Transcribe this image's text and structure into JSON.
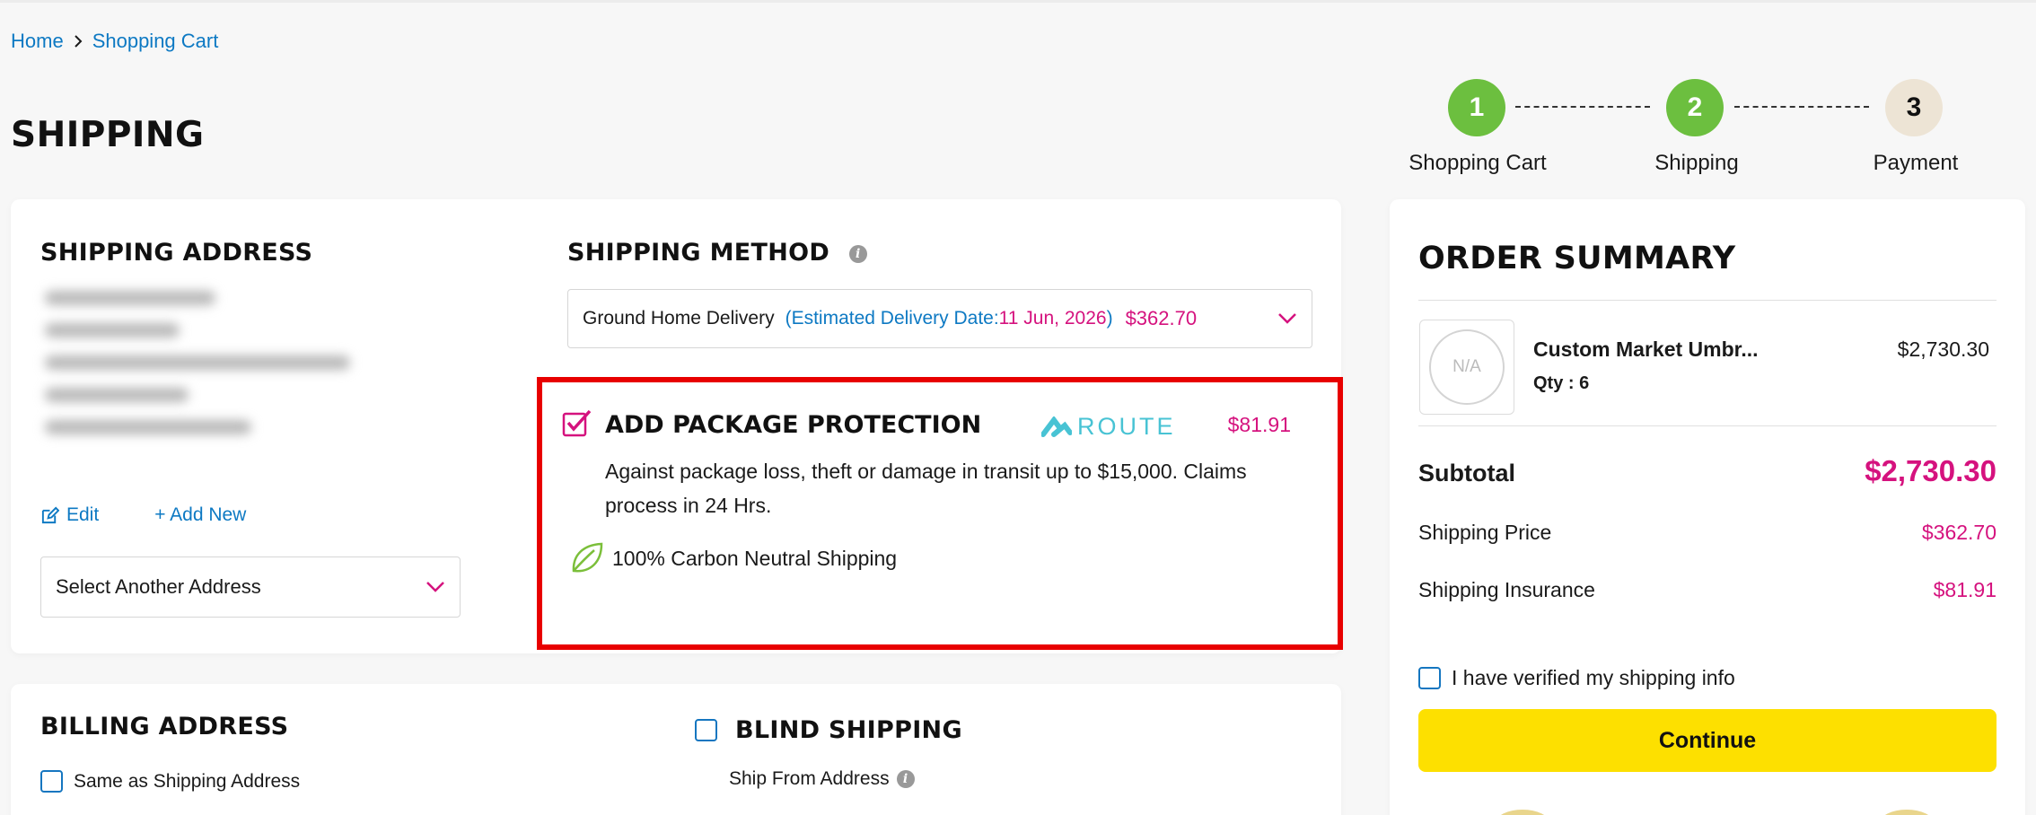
{
  "breadcrumb": {
    "home": "Home",
    "current": "Shopping Cart"
  },
  "page_title": "SHIPPING",
  "stepper": {
    "steps": [
      {
        "number": "1",
        "label": "Shopping Cart",
        "status": "done"
      },
      {
        "number": "2",
        "label": "Shipping",
        "status": "done"
      },
      {
        "number": "3",
        "label": "Payment",
        "status": "pending"
      }
    ]
  },
  "shipping_address": {
    "title": "SHIPPING ADDRESS",
    "edit_label": "Edit",
    "add_new_label": "+ Add New",
    "select_placeholder": "Select Another Address"
  },
  "shipping_method": {
    "title": "SHIPPING METHOD",
    "name": "Ground Home Delivery",
    "estimate_prefix": "(Estimated Delivery Date: ",
    "estimate_date": "11 Jun, 2026",
    "estimate_suffix": ")",
    "price": "$362.70"
  },
  "package_protection": {
    "title": "ADD PACKAGE PROTECTION",
    "brand": "ROUTE",
    "price": "$81.91",
    "checked": true,
    "description": "Against package loss, theft or damage in transit up to $15,000. Claims process in 24 Hrs.",
    "carbon_text": "100% Carbon Neutral Shipping"
  },
  "billing": {
    "title": "BILLING ADDRESS",
    "same_as_shipping": "Same as Shipping Address"
  },
  "blind_shipping": {
    "title": "BLIND SHIPPING",
    "ship_from_label": "Ship From Address"
  },
  "order_summary": {
    "title": "ORDER SUMMARY",
    "item": {
      "thumb": "N/A",
      "name": "Custom Market Umbr...",
      "qty": "Qty : 6",
      "price": "$2,730.30"
    },
    "subtotal_label": "Subtotal",
    "subtotal_value": "$2,730.30",
    "shipping_price_label": "Shipping Price",
    "shipping_price_value": "$362.70",
    "insurance_label": "Shipping Insurance",
    "insurance_value": "$81.91",
    "verify_label": "I have verified my shipping info",
    "continue_label": "Continue"
  },
  "colors": {
    "accent_pink": "#d5127e",
    "link_blue": "#0d79c3",
    "step_green": "#6cbf3f",
    "button_yellow": "#fde000",
    "highlight_red": "#e80000"
  }
}
